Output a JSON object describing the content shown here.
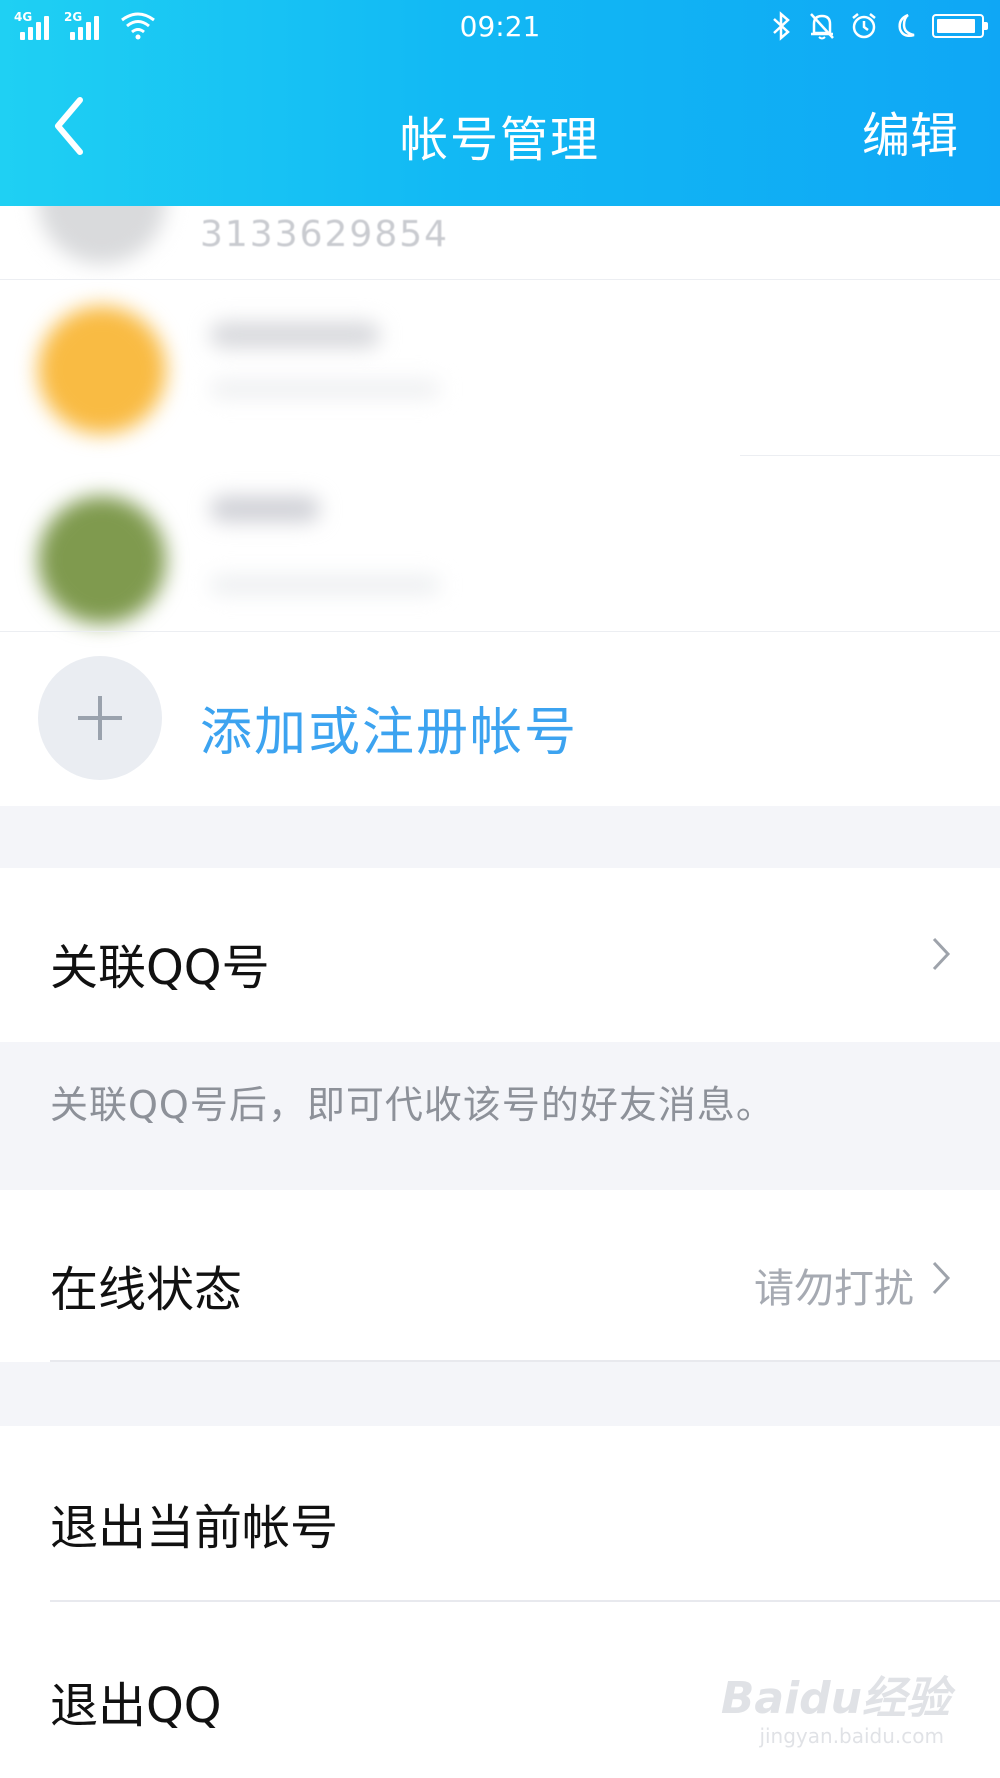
{
  "status_bar": {
    "time": "09:21",
    "network_1": "4G",
    "network_2": "2G"
  },
  "header": {
    "title": "帐号管理",
    "edit_label": "编辑"
  },
  "accounts": [
    {
      "number": "3133629854"
    }
  ],
  "add_account": {
    "label": "添加或注册帐号"
  },
  "link_qq": {
    "label": "关联QQ号",
    "hint": "关联QQ号后，即可代收该号的好友消息。"
  },
  "online_status": {
    "label": "在线状态",
    "value": "请勿打扰"
  },
  "logout_current": {
    "label": "退出当前帐号"
  },
  "logout_qq": {
    "label": "退出QQ"
  },
  "watermark": {
    "logo": "Baidu经验",
    "url": "jingyan.baidu.com"
  },
  "colors": {
    "header_gradient_start": "#1fd0f3",
    "header_gradient_end": "#0fa7f5",
    "accent_blue": "#3ca3f0",
    "section_gap": "#f4f5f9"
  }
}
